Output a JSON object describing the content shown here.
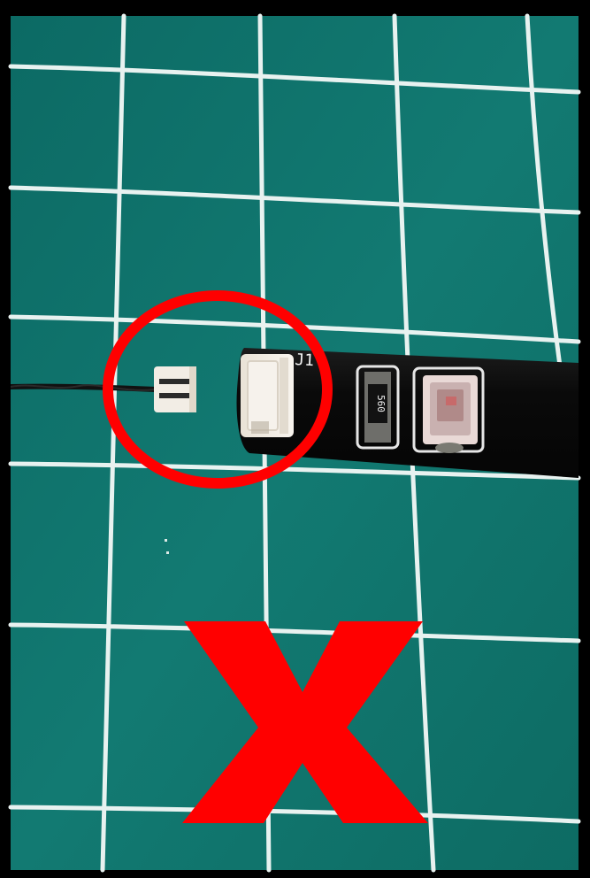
{
  "photo": {
    "strip_silkscreen_label": "J1",
    "resistor_marking": "560",
    "colors": {
      "frame": "#000000",
      "mat": "#0f6e66",
      "grid_line": "#e8f2f0",
      "strip": "#0b0b0b",
      "connector": "#f1ece4",
      "wire": "#111111",
      "annotation_red": "#ff0000"
    }
  },
  "annotations": {
    "highlight": "red-circle",
    "verdict_icon": "cross-mark-icon"
  }
}
